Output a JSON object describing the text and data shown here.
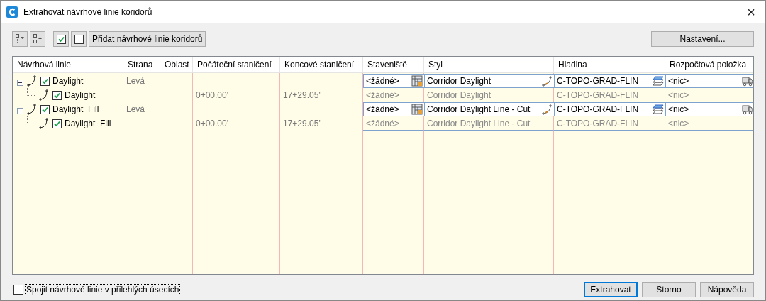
{
  "window": {
    "title": "Extrahovat návrhové linie koridorů",
    "close": "×"
  },
  "toolbar": {
    "icon_buttons": [
      {
        "kind": "expand"
      },
      {
        "kind": "collapse"
      },
      {
        "kind": "check-all"
      },
      {
        "kind": "uncheck-all"
      }
    ],
    "add_button": "Přidat návrhové linie koridorů",
    "settings_button": "Nastavení..."
  },
  "table": {
    "columns": [
      {
        "label": "Návrhová linie"
      },
      {
        "label": "Strana"
      },
      {
        "label": "Oblast"
      },
      {
        "label": "Počáteční staničení"
      },
      {
        "label": "Koncové staničení"
      },
      {
        "label": "Staveniště"
      },
      {
        "label": "Styl"
      },
      {
        "label": "Hladina"
      },
      {
        "label": "Rozpočtová položka"
      }
    ],
    "rows": [
      {
        "name": "Daylight",
        "checked": true,
        "expanded": true,
        "editable": true,
        "side": "Levá",
        "site": "<žádné>",
        "style": "Corridor Daylight",
        "layer": "C-TOPO-GRAD-FLIN",
        "pay_item": "<nic>",
        "children": [
          {
            "name": "Daylight",
            "checked": true,
            "editable": false,
            "start": "0+00.00'",
            "end": "17+29.05'",
            "site": "<žádné>",
            "style": "Corridor Daylight",
            "layer": "C-TOPO-GRAD-FLIN",
            "pay_item": "<nic>"
          }
        ]
      },
      {
        "name": "Daylight_Fill",
        "checked": true,
        "expanded": true,
        "editable": true,
        "side": "Levá",
        "site": "<žádné>",
        "style": "Corridor Daylight Line - Cut",
        "layer": "C-TOPO-GRAD-FLIN",
        "pay_item": "<nic>",
        "children": [
          {
            "name": "Daylight_Fill",
            "checked": true,
            "editable": false,
            "start": "0+00.00'",
            "end": "17+29.05'",
            "site": "<žádné>",
            "style": "Corridor Daylight Line - Cut",
            "layer": "C-TOPO-GRAD-FLIN",
            "pay_item": "<nic>"
          }
        ]
      }
    ]
  },
  "footer": {
    "join_option": {
      "label": "Spojit návrhové linie v přilehlých úsecích",
      "checked": false
    },
    "buttons": [
      {
        "label": "Extrahovat",
        "default": true
      },
      {
        "label": "Storno",
        "default": false
      },
      {
        "label": "Nápověda",
        "default": false
      }
    ]
  }
}
